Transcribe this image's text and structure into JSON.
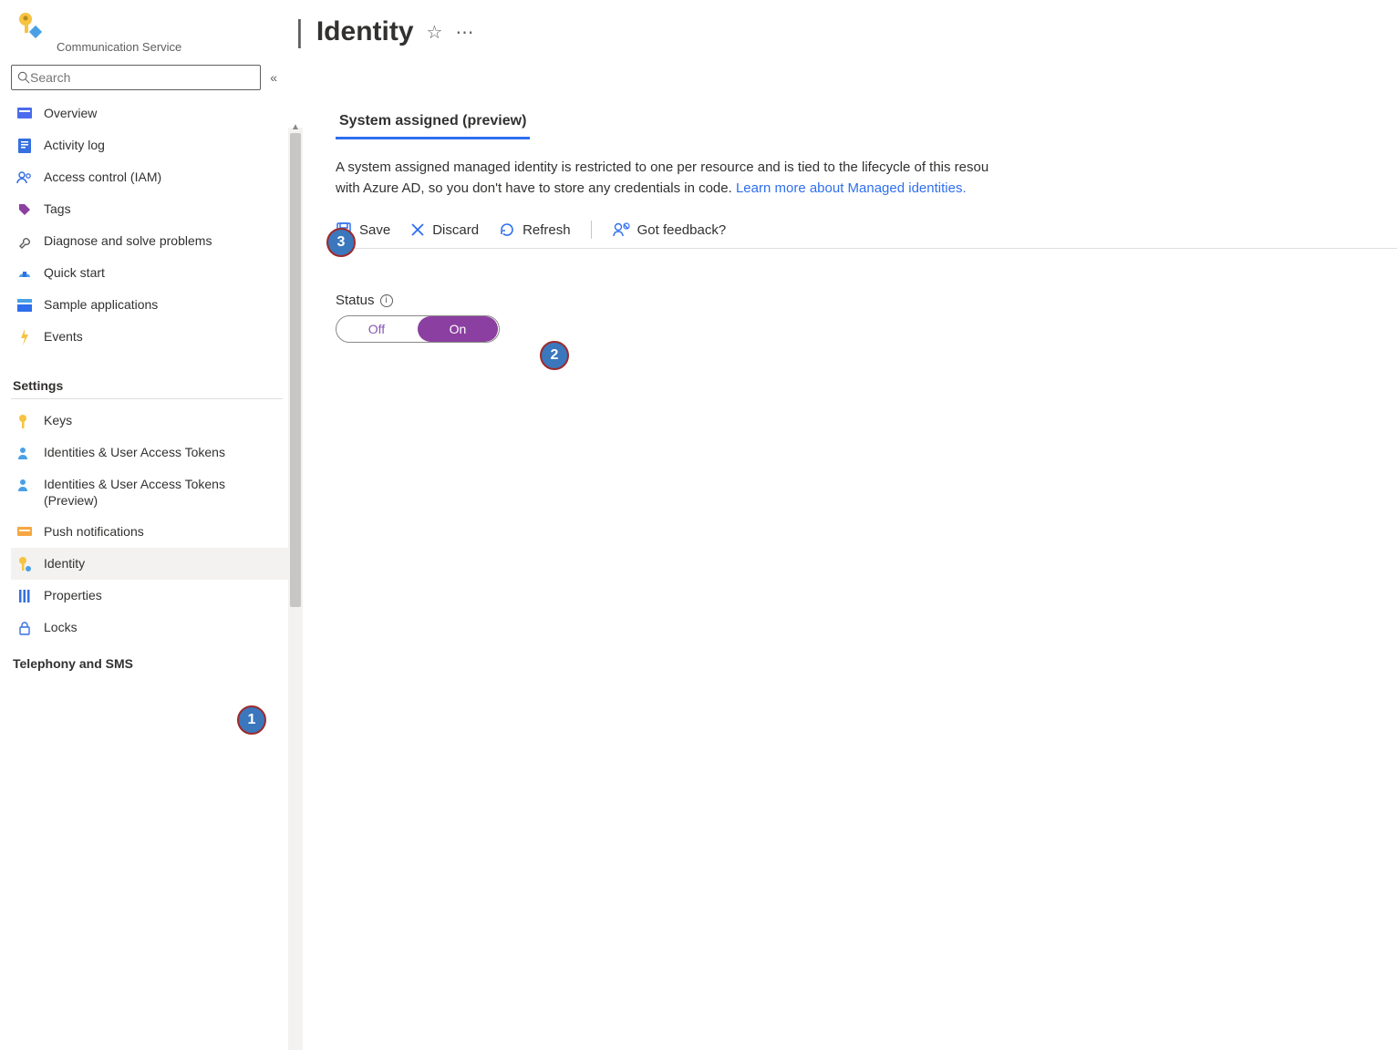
{
  "resource": {
    "subtitle": "Communication Service"
  },
  "search": {
    "placeholder": "Search"
  },
  "sidebar": {
    "items": [
      {
        "label": "Overview"
      },
      {
        "label": "Activity log"
      },
      {
        "label": "Access control (IAM)"
      },
      {
        "label": "Tags"
      },
      {
        "label": "Diagnose and solve problems"
      },
      {
        "label": "Quick start"
      },
      {
        "label": "Sample applications"
      },
      {
        "label": "Events"
      }
    ],
    "settings_header": "Settings",
    "settings_items": [
      {
        "label": "Keys"
      },
      {
        "label": "Identities & User Access Tokens"
      },
      {
        "label": "Identities & User Access Tokens (Preview)"
      },
      {
        "label": "Push notifications"
      },
      {
        "label": "Identity"
      },
      {
        "label": "Properties"
      },
      {
        "label": "Locks"
      }
    ],
    "telephony_header": "Telephony and SMS"
  },
  "page": {
    "title": "Identity",
    "tab_label": "System assigned (preview)",
    "description_prefix": "A system assigned managed identity is restricted to one per resource and is tied to the lifecycle of this resou",
    "description_line2_prefix": "with Azure AD, so you don't have to store any credentials in code. ",
    "learn_more": "Learn more about Managed identities.",
    "cmd": {
      "save": "Save",
      "discard": "Discard",
      "refresh": "Refresh",
      "feedback": "Got feedback?"
    },
    "status_label": "Status",
    "toggle_off": "Off",
    "toggle_on": "On"
  },
  "annotations": {
    "b1": "1",
    "b2": "2",
    "b3": "3"
  }
}
